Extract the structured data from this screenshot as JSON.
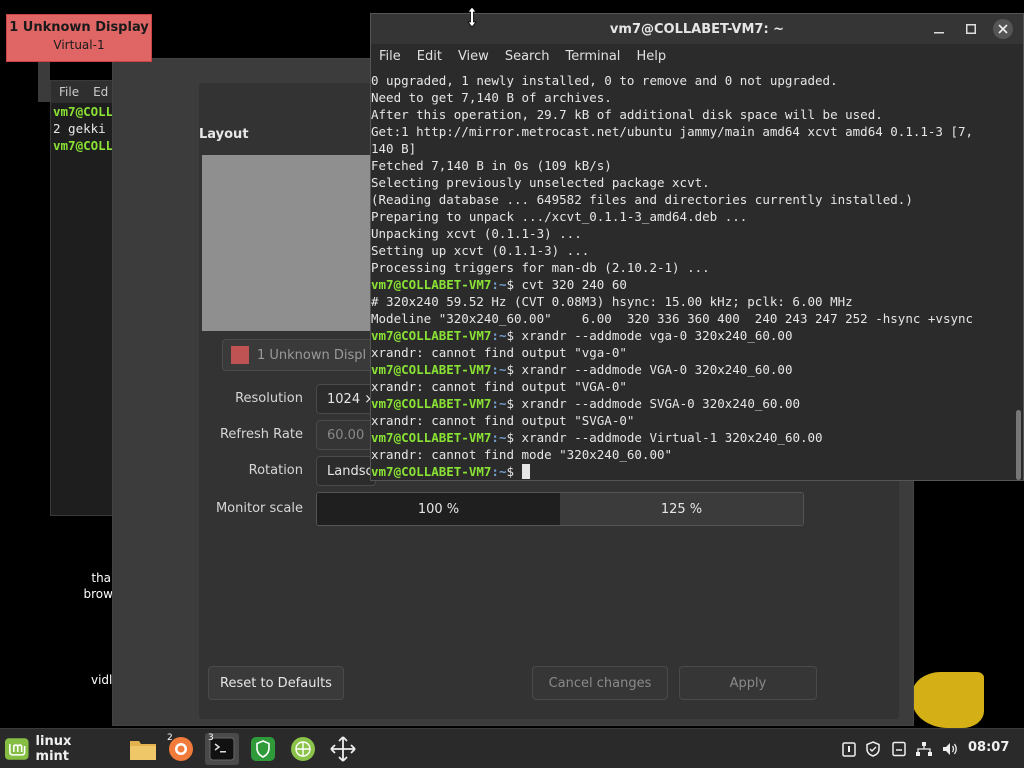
{
  "tooltip": {
    "line1": "1  Unknown Display",
    "line2": "Virtual-1"
  },
  "bg_terminal": {
    "menu": [
      "File",
      "Ed"
    ],
    "lines": [
      {
        "prompt": "vm7@COLL",
        "text": ""
      },
      {
        "prompt": "",
        "text": "2 gekki"
      },
      {
        "prompt": "vm7@COLL",
        "text": ""
      }
    ]
  },
  "desktop_icons": [
    {
      "label1": "than",
      "label2": "browse"
    },
    {
      "label1": "vidlii",
      "label2": ""
    }
  ],
  "display_dialog": {
    "layout_title": "Layout",
    "monitor_select": "1   Unknown Displ",
    "resolution_label": "Resolution",
    "resolution_value": "1024 ×",
    "refresh_label": "Refresh Rate",
    "refresh_value": "60.00",
    "rotation_label": "Rotation",
    "rotation_value": "Landsc",
    "scale_label": "Monitor scale",
    "scale_options": [
      "100 %",
      "125 %"
    ],
    "reset_button": "Reset to Defaults",
    "cancel_button": "Cancel changes",
    "apply_button": "Apply",
    "monitor_color": "#bf5353"
  },
  "terminal": {
    "title": "vm7@COLLABET-VM7: ~",
    "menu": [
      "File",
      "Edit",
      "View",
      "Search",
      "Terminal",
      "Help"
    ],
    "prompt_user": "vm7@COLLABET-VM7",
    "prompt_path": ":~",
    "prompt_symbol": "$ ",
    "lines": [
      {
        "type": "out",
        "text": "0 upgraded, 1 newly installed, 0 to remove and 0 not upgraded."
      },
      {
        "type": "out",
        "text": "Need to get 7,140 B of archives."
      },
      {
        "type": "out",
        "text": "After this operation, 29.7 kB of additional disk space will be used."
      },
      {
        "type": "out",
        "text": "Get:1 http://mirror.metrocast.net/ubuntu jammy/main amd64 xcvt amd64 0.1.1-3 [7,"
      },
      {
        "type": "out",
        "text": "140 B]"
      },
      {
        "type": "out",
        "text": "Fetched 7,140 B in 0s (109 kB/s)"
      },
      {
        "type": "out",
        "text": "Selecting previously unselected package xcvt."
      },
      {
        "type": "out",
        "text": "(Reading database ... 649582 files and directories currently installed.)"
      },
      {
        "type": "out",
        "text": "Preparing to unpack .../xcvt_0.1.1-3_amd64.deb ..."
      },
      {
        "type": "out",
        "text": "Unpacking xcvt (0.1.1-3) ..."
      },
      {
        "type": "out",
        "text": "Setting up xcvt (0.1.1-3) ..."
      },
      {
        "type": "out",
        "text": "Processing triggers for man-db (2.10.2-1) ..."
      },
      {
        "type": "cmd",
        "text": "cvt 320 240 60"
      },
      {
        "type": "out",
        "text": "# 320x240 59.52 Hz (CVT 0.08M3) hsync: 15.00 kHz; pclk: 6.00 MHz"
      },
      {
        "type": "out",
        "text": "Modeline \"320x240_60.00\"    6.00  320 336 360 400  240 243 247 252 -hsync +vsync"
      },
      {
        "type": "cmd",
        "text": "xrandr --addmode vga-0 320x240_60.00"
      },
      {
        "type": "out",
        "text": "xrandr: cannot find output \"vga-0\""
      },
      {
        "type": "cmd",
        "text": "xrandr --addmode VGA-0 320x240_60.00"
      },
      {
        "type": "out",
        "text": "xrandr: cannot find output \"VGA-0\""
      },
      {
        "type": "cmd",
        "text": "xrandr --addmode SVGA-0 320x240_60.00"
      },
      {
        "type": "out",
        "text": "xrandr: cannot find output \"SVGA-0\""
      },
      {
        "type": "cmd",
        "text": "xrandr --addmode Virtual-1 320x240_60.00"
      },
      {
        "type": "out",
        "text": "xrandr: cannot find mode \"320x240_60.00\""
      },
      {
        "type": "cmd",
        "text": ""
      }
    ]
  },
  "taskbar": {
    "menu_label": "linux mint",
    "apps": [
      {
        "name": "files",
        "badge": ""
      },
      {
        "name": "firefox",
        "badge": "2"
      },
      {
        "name": "terminal",
        "badge": "3"
      },
      {
        "name": "shield",
        "badge": ""
      },
      {
        "name": "network",
        "badge": ""
      },
      {
        "name": "move",
        "badge": ""
      }
    ],
    "clock": "08:07"
  }
}
